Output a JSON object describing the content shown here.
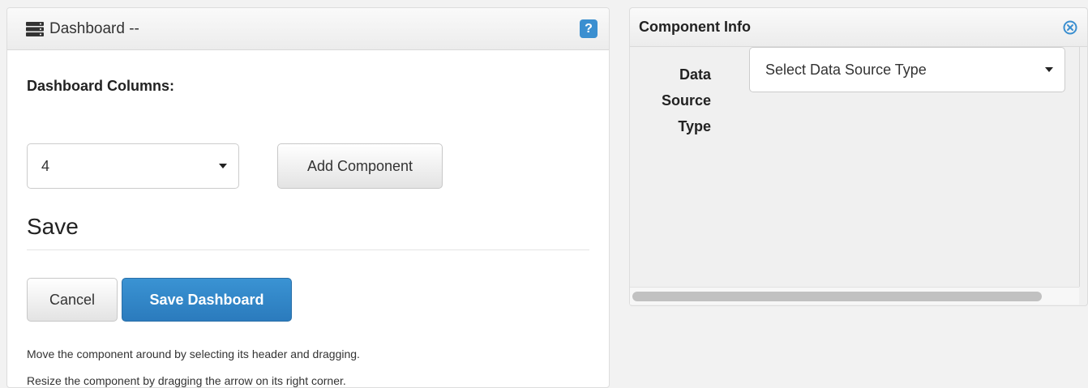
{
  "dashboard": {
    "title": "Dashboard --",
    "title_icon": "server-stack-icon",
    "help_label": "?",
    "columns_label": "Dashboard Columns:",
    "columns_value": "4",
    "add_component_label": "Add Component",
    "save_heading": "Save",
    "cancel_label": "Cancel",
    "save_dashboard_label": "Save Dashboard",
    "help_text_1": "Move the component around by selecting its header and dragging.",
    "help_text_2": "Resize the component by dragging the arrow on its right corner."
  },
  "component_info": {
    "title": "Component Info",
    "close_icon": "close-circle-icon",
    "data_source_label_1": "Data",
    "data_source_label_2": "Source",
    "data_source_label_3": "Type",
    "data_source_value": "Select Data Source Type"
  },
  "colors": {
    "primary_button": "#2b7bbd",
    "help_icon": "#3b8fd0",
    "close_icon": "#3b8fd0"
  }
}
